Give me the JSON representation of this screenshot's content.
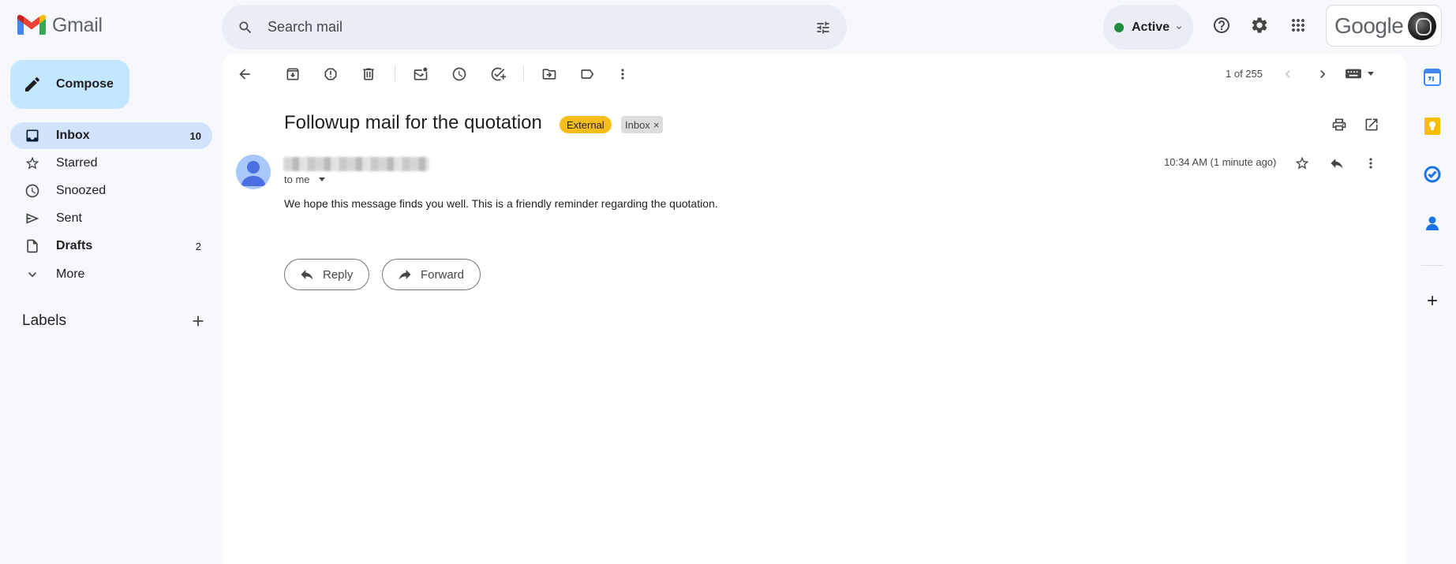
{
  "header": {
    "app_name": "Gmail",
    "search_placeholder": "Search mail",
    "status_label": "Active",
    "account_brand": "Google"
  },
  "sidebar": {
    "compose_label": "Compose",
    "items": [
      {
        "label": "Inbox",
        "count": "10",
        "icon": "inbox-icon"
      },
      {
        "label": "Starred",
        "count": "",
        "icon": "star-icon"
      },
      {
        "label": "Snoozed",
        "count": "",
        "icon": "clock-icon"
      },
      {
        "label": "Sent",
        "count": "",
        "icon": "send-icon"
      },
      {
        "label": "Drafts",
        "count": "2",
        "icon": "draft-icon"
      },
      {
        "label": "More",
        "count": "",
        "icon": "chevron-down-icon"
      }
    ],
    "labels_title": "Labels"
  },
  "toolbar": {
    "pager": "1 of 255"
  },
  "email": {
    "subject": "Followup mail for the quotation",
    "tag_external": "External",
    "tag_inbox": "Inbox",
    "tag_remove": "×",
    "to": "to me",
    "time": "10:34 AM (1 minute ago)",
    "body": "We hope this message finds you well. This is a friendly reminder regarding the quotation.",
    "reply_label": "Reply",
    "forward_label": "Forward"
  },
  "colors": {
    "background": "#f6f8fc",
    "compose": "#c2e7ff",
    "active_nav": "#d3e3fd",
    "external_tag": "#f7bd1b",
    "status_green": "#1e8e3e"
  }
}
